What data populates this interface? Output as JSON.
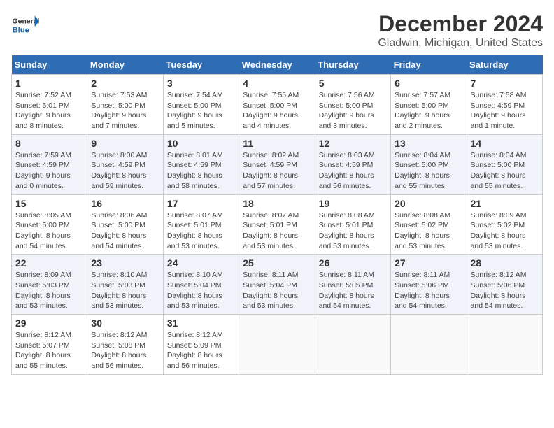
{
  "logo": {
    "line1": "General",
    "line2": "Blue"
  },
  "title": "December 2024",
  "subtitle": "Gladwin, Michigan, United States",
  "headers": [
    "Sunday",
    "Monday",
    "Tuesday",
    "Wednesday",
    "Thursday",
    "Friday",
    "Saturday"
  ],
  "weeks": [
    [
      {
        "day": "1",
        "detail": "Sunrise: 7:52 AM\nSunset: 5:01 PM\nDaylight: 9 hours\nand 8 minutes."
      },
      {
        "day": "2",
        "detail": "Sunrise: 7:53 AM\nSunset: 5:00 PM\nDaylight: 9 hours\nand 7 minutes."
      },
      {
        "day": "3",
        "detail": "Sunrise: 7:54 AM\nSunset: 5:00 PM\nDaylight: 9 hours\nand 5 minutes."
      },
      {
        "day": "4",
        "detail": "Sunrise: 7:55 AM\nSunset: 5:00 PM\nDaylight: 9 hours\nand 4 minutes."
      },
      {
        "day": "5",
        "detail": "Sunrise: 7:56 AM\nSunset: 5:00 PM\nDaylight: 9 hours\nand 3 minutes."
      },
      {
        "day": "6",
        "detail": "Sunrise: 7:57 AM\nSunset: 5:00 PM\nDaylight: 9 hours\nand 2 minutes."
      },
      {
        "day": "7",
        "detail": "Sunrise: 7:58 AM\nSunset: 4:59 PM\nDaylight: 9 hours\nand 1 minute."
      }
    ],
    [
      {
        "day": "8",
        "detail": "Sunrise: 7:59 AM\nSunset: 4:59 PM\nDaylight: 9 hours\nand 0 minutes."
      },
      {
        "day": "9",
        "detail": "Sunrise: 8:00 AM\nSunset: 4:59 PM\nDaylight: 8 hours\nand 59 minutes."
      },
      {
        "day": "10",
        "detail": "Sunrise: 8:01 AM\nSunset: 4:59 PM\nDaylight: 8 hours\nand 58 minutes."
      },
      {
        "day": "11",
        "detail": "Sunrise: 8:02 AM\nSunset: 4:59 PM\nDaylight: 8 hours\nand 57 minutes."
      },
      {
        "day": "12",
        "detail": "Sunrise: 8:03 AM\nSunset: 4:59 PM\nDaylight: 8 hours\nand 56 minutes."
      },
      {
        "day": "13",
        "detail": "Sunrise: 8:04 AM\nSunset: 5:00 PM\nDaylight: 8 hours\nand 55 minutes."
      },
      {
        "day": "14",
        "detail": "Sunrise: 8:04 AM\nSunset: 5:00 PM\nDaylight: 8 hours\nand 55 minutes."
      }
    ],
    [
      {
        "day": "15",
        "detail": "Sunrise: 8:05 AM\nSunset: 5:00 PM\nDaylight: 8 hours\nand 54 minutes."
      },
      {
        "day": "16",
        "detail": "Sunrise: 8:06 AM\nSunset: 5:00 PM\nDaylight: 8 hours\nand 54 minutes."
      },
      {
        "day": "17",
        "detail": "Sunrise: 8:07 AM\nSunset: 5:01 PM\nDaylight: 8 hours\nand 53 minutes."
      },
      {
        "day": "18",
        "detail": "Sunrise: 8:07 AM\nSunset: 5:01 PM\nDaylight: 8 hours\nand 53 minutes."
      },
      {
        "day": "19",
        "detail": "Sunrise: 8:08 AM\nSunset: 5:01 PM\nDaylight: 8 hours\nand 53 minutes."
      },
      {
        "day": "20",
        "detail": "Sunrise: 8:08 AM\nSunset: 5:02 PM\nDaylight: 8 hours\nand 53 minutes."
      },
      {
        "day": "21",
        "detail": "Sunrise: 8:09 AM\nSunset: 5:02 PM\nDaylight: 8 hours\nand 53 minutes."
      }
    ],
    [
      {
        "day": "22",
        "detail": "Sunrise: 8:09 AM\nSunset: 5:03 PM\nDaylight: 8 hours\nand 53 minutes."
      },
      {
        "day": "23",
        "detail": "Sunrise: 8:10 AM\nSunset: 5:03 PM\nDaylight: 8 hours\nand 53 minutes."
      },
      {
        "day": "24",
        "detail": "Sunrise: 8:10 AM\nSunset: 5:04 PM\nDaylight: 8 hours\nand 53 minutes."
      },
      {
        "day": "25",
        "detail": "Sunrise: 8:11 AM\nSunset: 5:04 PM\nDaylight: 8 hours\nand 53 minutes."
      },
      {
        "day": "26",
        "detail": "Sunrise: 8:11 AM\nSunset: 5:05 PM\nDaylight: 8 hours\nand 54 minutes."
      },
      {
        "day": "27",
        "detail": "Sunrise: 8:11 AM\nSunset: 5:06 PM\nDaylight: 8 hours\nand 54 minutes."
      },
      {
        "day": "28",
        "detail": "Sunrise: 8:12 AM\nSunset: 5:06 PM\nDaylight: 8 hours\nand 54 minutes."
      }
    ],
    [
      {
        "day": "29",
        "detail": "Sunrise: 8:12 AM\nSunset: 5:07 PM\nDaylight: 8 hours\nand 55 minutes."
      },
      {
        "day": "30",
        "detail": "Sunrise: 8:12 AM\nSunset: 5:08 PM\nDaylight: 8 hours\nand 56 minutes."
      },
      {
        "day": "31",
        "detail": "Sunrise: 8:12 AM\nSunset: 5:09 PM\nDaylight: 8 hours\nand 56 minutes."
      },
      {
        "day": "",
        "detail": ""
      },
      {
        "day": "",
        "detail": ""
      },
      {
        "day": "",
        "detail": ""
      },
      {
        "day": "",
        "detail": ""
      }
    ]
  ]
}
